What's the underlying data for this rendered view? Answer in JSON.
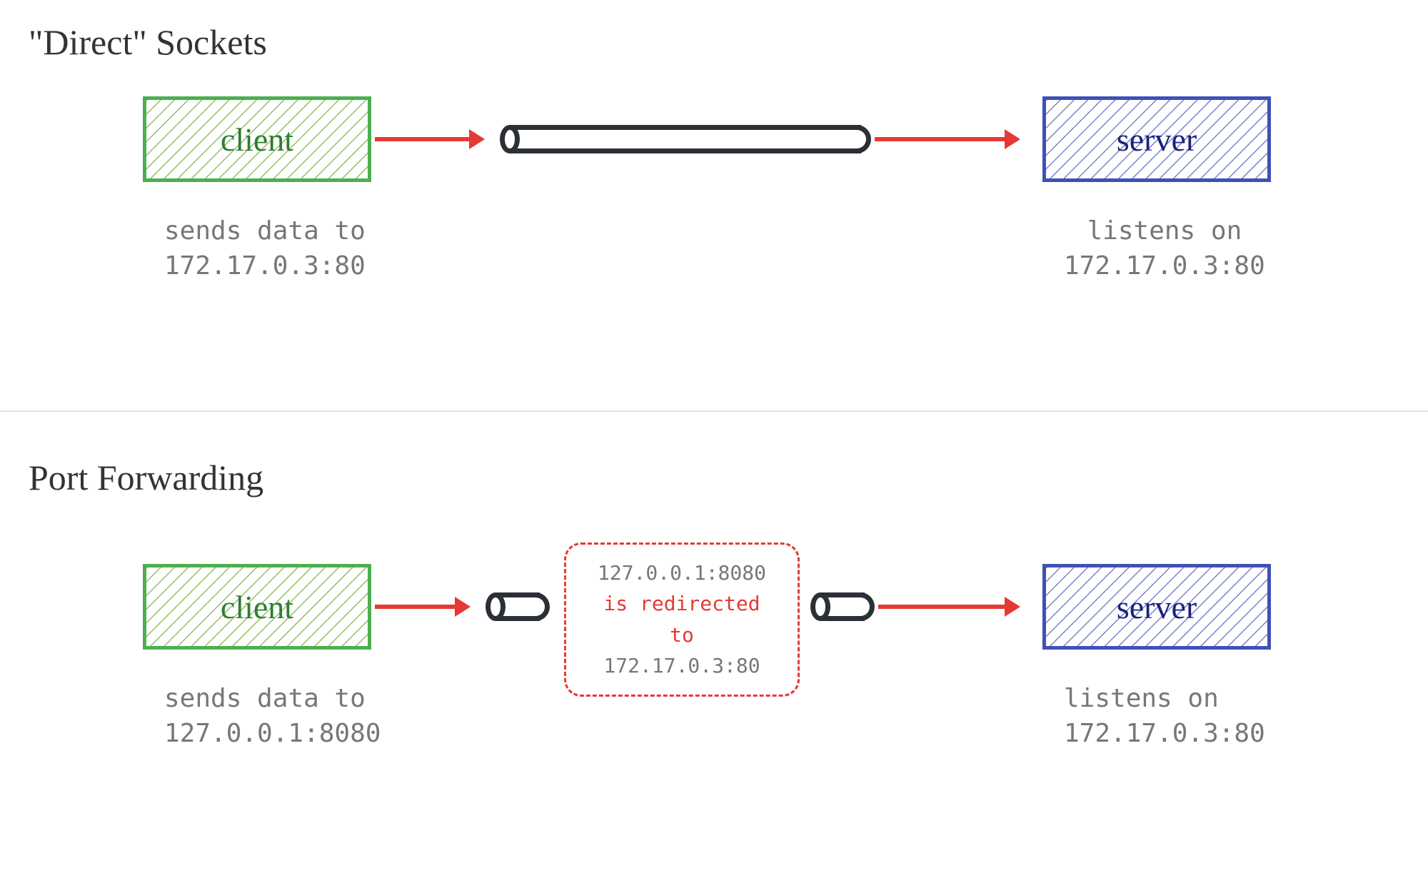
{
  "section1": {
    "title": "\"Direct\" Sockets",
    "client": {
      "label": "client",
      "caption": "sends data to\n172.17.0.3:80"
    },
    "server": {
      "label": "server",
      "caption": "listens on\n172.17.0.3:80"
    }
  },
  "section2": {
    "title": "Port Forwarding",
    "client": {
      "label": "client",
      "caption": "sends data to\n127.0.0.1:8080"
    },
    "server": {
      "label": "server",
      "caption": "listens on\n172.17.0.3:80"
    },
    "redirect": {
      "from": "127.0.0.1:8080",
      "mid": "is redirected to",
      "to": "172.17.0.3:80"
    }
  },
  "colors": {
    "client_stroke": "#4caf50",
    "server_stroke": "#3f51b5",
    "arrow": "#e53935",
    "pipe": "#2b2f36"
  }
}
